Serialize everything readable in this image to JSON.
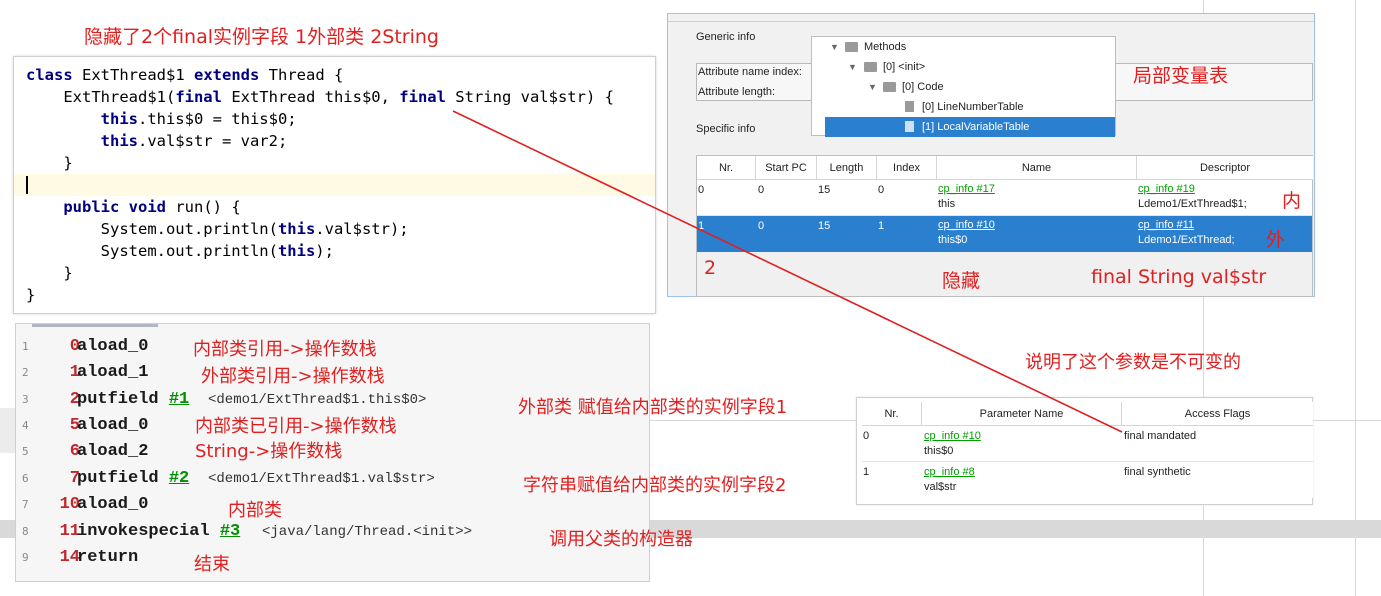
{
  "annotations": {
    "top_note": "隐藏了2个final实例字段   1外部类 2String",
    "local_var_table": "局部变量表",
    "inner": "内",
    "outer": "外",
    "two": "2",
    "hidden": "隐藏",
    "final_field": "final String val$str",
    "immutable_param": "说明了这个参数是不可变的",
    "bc_comments": [
      "内部类引用->操作数栈",
      "外部类引用->操作数栈",
      "外部类 赋值给内部类的实例字段1",
      "内部类已引用->操作数栈",
      "String->操作数栈",
      "字符串赋值给内部类的实例字段2",
      "内部类",
      "调用父类的构造器",
      "结束"
    ],
    "arrow_color": "#e02020"
  },
  "code": {
    "l1_kw1": "class",
    "l1_rest1": " ExtThread$1 ",
    "l1_kw2": "extends",
    "l1_rest2": " Thread {",
    "l2_a": "    ExtThread$1(",
    "l2_kw1": "final",
    "l2_b": " ExtThread this$0, ",
    "l2_kw2": "final",
    "l2_c": " String val$str) {",
    "l3_kw": "this",
    "l3_rest": ".this$0 = this$0;",
    "l4_kw": "this",
    "l4_rest": ".val$str = var2;",
    "l5": "    }",
    "l7_kw1": "public",
    "l7_kw2": "void",
    "l7_rest": " run() {",
    "l8_a": "        System.out.println(",
    "l8_kw": "this",
    "l8_b": ".val$str);",
    "l9_a": "        System.out.println(",
    "l9_kw": "this",
    "l9_b": ");",
    "l10": "    }",
    "l11": "}"
  },
  "bytecode": [
    {
      "line": "1",
      "idx": "0",
      "op": "aload_0",
      "ref": "",
      "cmt": ""
    },
    {
      "line": "2",
      "idx": "1",
      "op": "aload_1",
      "ref": "",
      "cmt": ""
    },
    {
      "line": "3",
      "idx": "2",
      "op": "putfield ",
      "ref": "#1",
      "cmt": "<demo1/ExtThread$1.this$0>"
    },
    {
      "line": "4",
      "idx": "5",
      "op": "aload_0",
      "ref": "",
      "cmt": ""
    },
    {
      "line": "5",
      "idx": "6",
      "op": "aload_2",
      "ref": "",
      "cmt": ""
    },
    {
      "line": "6",
      "idx": "7",
      "op": "putfield ",
      "ref": "#2",
      "cmt": "<demo1/ExtThread$1.val$str>"
    },
    {
      "line": "7",
      "idx": "10",
      "op": "aload_0",
      "ref": "",
      "cmt": ""
    },
    {
      "line": "8",
      "idx": "11",
      "op": "invokespecial ",
      "ref": "#3",
      "cmt": "<java/lang/Thread.<init>>"
    },
    {
      "line": "9",
      "idx": "14",
      "op": "return",
      "ref": "",
      "cmt": ""
    }
  ],
  "jclasslib": {
    "generic_info": "Generic info",
    "attr_name_label": "Attribute name index:",
    "attr_len_label": "Attribute length:",
    "specific_info": "Specific info",
    "tree": {
      "methods": "Methods",
      "init": "[0] <init>",
      "code": "[0] Code",
      "lnt": "[0] LineNumberTable",
      "lvt": "[1] LocalVariableTable"
    },
    "lvt_headers": [
      "Nr.",
      "Start PC",
      "Length",
      "Index",
      "Name",
      "Descriptor"
    ],
    "lvt_rows": [
      {
        "nr": "0",
        "start": "0",
        "length": "15",
        "index": "0",
        "name_ref": "cp_info #17",
        "name": "this",
        "desc_ref": "cp_info #19",
        "desc": "Ldemo1/ExtThread$1;"
      },
      {
        "nr": "1",
        "start": "0",
        "length": "15",
        "index": "1",
        "name_ref": "cp_info #10",
        "name": "this$0",
        "desc_ref": "cp_info #11",
        "desc": "Ldemo1/ExtThread;"
      }
    ]
  },
  "params": {
    "headers": [
      "Nr.",
      "Parameter Name",
      "Access Flags"
    ],
    "rows": [
      {
        "nr": "0",
        "ref": "cp_info #10",
        "name": "this$0",
        "flags": "final mandated"
      },
      {
        "nr": "1",
        "ref": "cp_info #8",
        "name": "val$str",
        "flags": "final synthetic"
      }
    ]
  }
}
